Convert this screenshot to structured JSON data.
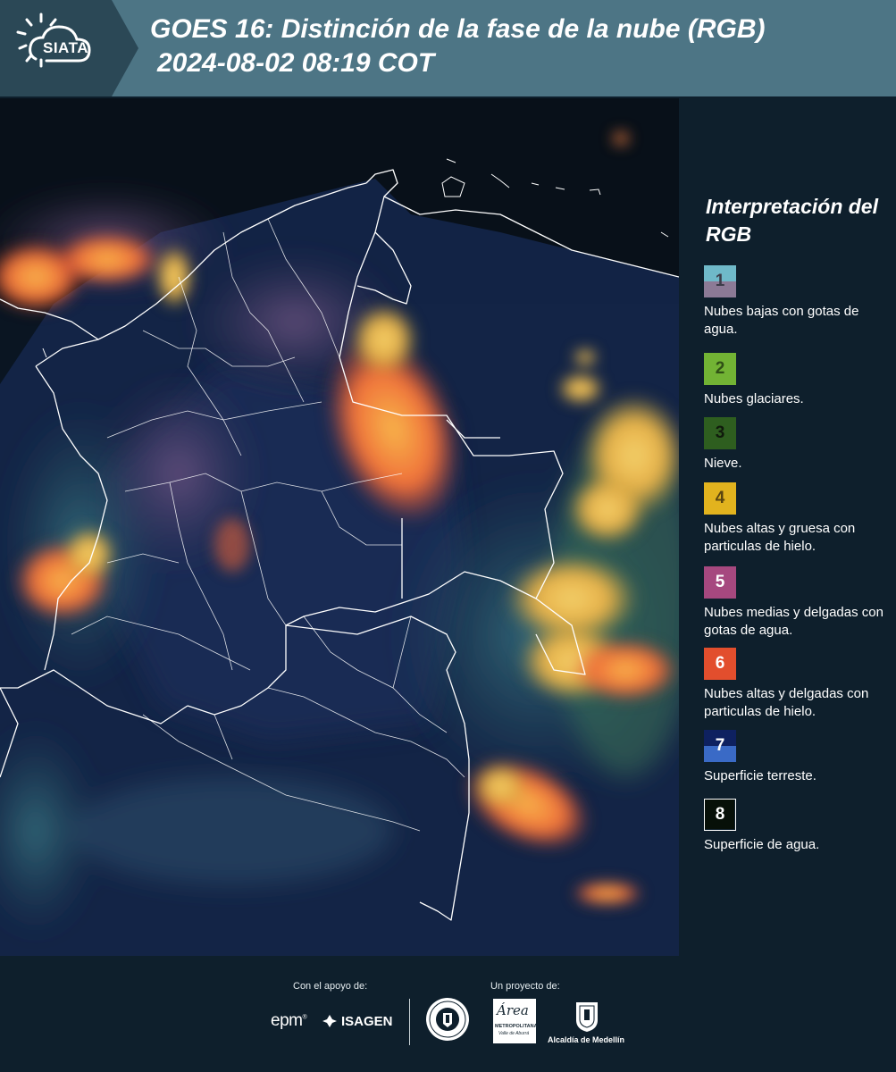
{
  "header": {
    "logo_text": "SIATA",
    "title": "GOES 16: Distinción de la fase de la nube (RGB)",
    "datetime": "2024-08-02 08:19 COT"
  },
  "legend": {
    "title": "Interpretación del RGB",
    "items": [
      {
        "num": "1",
        "label": "Nubes bajas con gotas de agua.",
        "color_top": "#6fb9c9",
        "color_bottom": "#8c7a96",
        "num_color": "#3d3d4a"
      },
      {
        "num": "2",
        "label": "Nubes glaciares.",
        "color_top": "#72b334",
        "color_bottom": "#72b334",
        "num_color": "#2f4f16"
      },
      {
        "num": "3",
        "label": "Nieve.",
        "color_top": "#2e5e1f",
        "color_bottom": "#2e5e1f",
        "num_color": "#101a0c"
      },
      {
        "num": "4",
        "label": "Nubes altas y gruesa con particulas de hielo.",
        "color_top": "#e2b31e",
        "color_bottom": "#e2b31e",
        "num_color": "#5a4510"
      },
      {
        "num": "5",
        "label": "Nubes medias y delgadas con gotas de agua.",
        "color_top": "#a6487f",
        "color_bottom": "#a6487f",
        "num_color": "#ffffff"
      },
      {
        "num": "6",
        "label": "Nubes altas y delgadas con particulas de hielo.",
        "color_top": "#e24e2d",
        "color_bottom": "#e24e2d",
        "num_color": "#ffffff"
      },
      {
        "num": "7",
        "label": "Superficie terreste.",
        "color_top": "#0e2160",
        "color_bottom": "#3a6ac6",
        "num_color": "#ffffff"
      },
      {
        "num": "8",
        "label": "Superficie de agua.",
        "color_top": "#071008",
        "color_bottom": "#071008",
        "num_color": "#ffffff"
      }
    ]
  },
  "footer": {
    "support_label": "Con el apoyo de:",
    "project_label": "Un proyecto de:",
    "sponsor_epm": "epm",
    "sponsor_isagen": "ISAGEN",
    "area_name": "Área",
    "area_sub1": "METROPOLITANA",
    "area_sub2": "Valle de Aburrá",
    "alcaldia": "Alcaldía de Medellín"
  }
}
